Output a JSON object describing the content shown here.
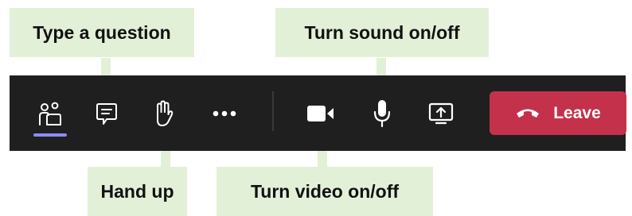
{
  "callouts": {
    "type_question": "Type a question",
    "sound": "Turn sound on/off",
    "hand_up": "Hand up",
    "video": "Turn video on/off"
  },
  "toolbar": {
    "buttons": [
      {
        "icon": "people-icon",
        "active": true
      },
      {
        "icon": "chat-icon"
      },
      {
        "icon": "raise-hand-icon"
      },
      {
        "icon": "more-options-icon"
      },
      {
        "icon": "camera-icon"
      },
      {
        "icon": "microphone-icon"
      },
      {
        "icon": "share-screen-icon"
      }
    ],
    "leave_label": "Leave"
  },
  "colors": {
    "toolbar_bg": "#1f1f1f",
    "callout_bg": "#e3f0d8",
    "leave_bg": "#c4314b",
    "active_indicator": "#8b8cff",
    "icon": "#ffffff"
  }
}
